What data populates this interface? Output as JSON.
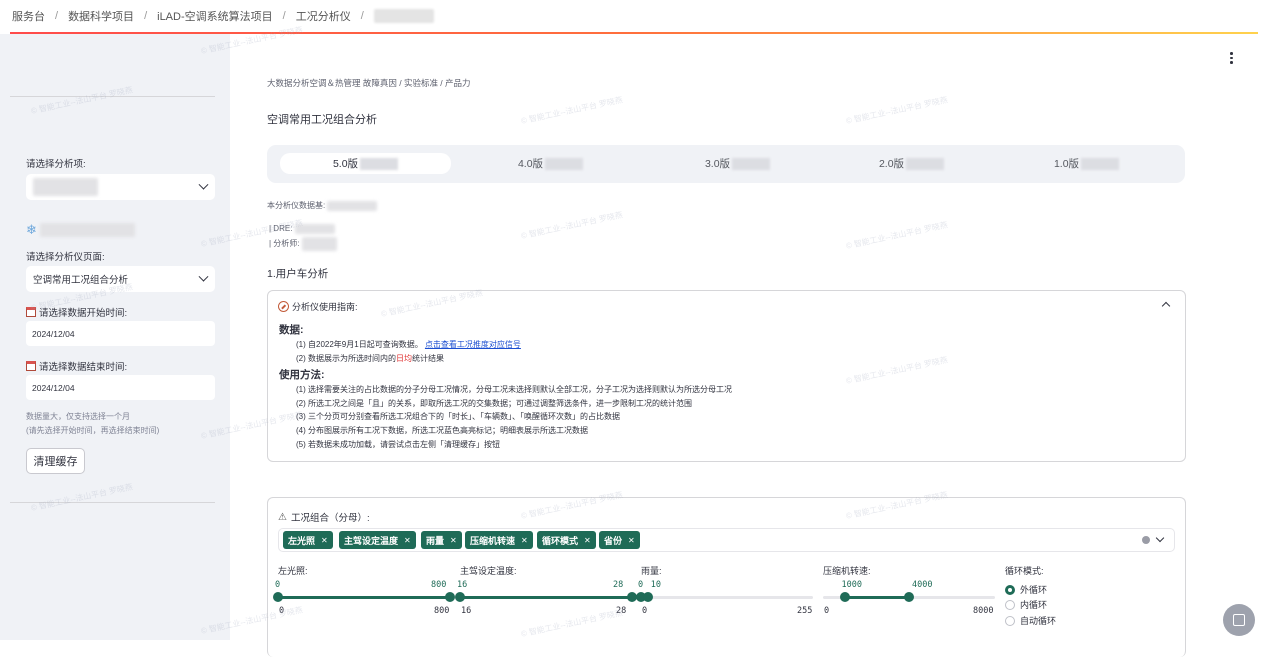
{
  "breadcrumb": {
    "items": [
      "服务台",
      "数据科学项目",
      "iLAD-空调系统算法项目",
      "工况分析仪"
    ],
    "separator": "/"
  },
  "watermark": "© 智能工业--法山平台 罗晓燕",
  "sidebar": {
    "analysis_item_label": "请选择分析项:",
    "page_label": "请选择分析仪页面:",
    "page_value": "空调常用工况组合分析",
    "start_label": "请选择数据开始时间:",
    "start_value": "2024/12/04",
    "end_label": "请选择数据结束时间:",
    "end_value": "2024/12/04",
    "note_line1": "数据量大，仅支持选择一个月",
    "note_line2": "(请先选择开始时间，再选择结束时间)",
    "clear_cache": "清理缓存"
  },
  "main": {
    "path_text": "大数据分析空调＆热管理 故障真因 / 实验标准 / 产品力",
    "title": "空调常用工况组合分析",
    "tabs": [
      "5.0版",
      "4.0版",
      "3.0版",
      "2.0版",
      "1.0版"
    ],
    "active_tab": 0,
    "meta_base": "本分析仪数据基:",
    "meta_dre": "| DRE:",
    "meta_analyst": "| 分析师:",
    "section_title": "1.用户车分析"
  },
  "guide": {
    "header": "分析仪使用指南:",
    "data_heading": "数据:",
    "data_line1_prefix": "(1) 自2022年9月1日起可查询数据。",
    "data_line1_link": "点击查看工况推度对应信号",
    "data_line2_prefix": "(2) 数据展示为所选时间内的",
    "data_line2_red": "日均",
    "data_line2_suffix": "统计结果",
    "method_heading": "使用方法:",
    "method_lines": [
      "(1) 选择需要关注的占比数据的分子分母工况情况，分母工况未选择则默认全部工况，分子工况为选择则默认为所选分母工况",
      "(2) 所选工况之间是「且」的关系，即取所选工况的交集数据；可通过调整筛选条件，进一步限制工况的统计范围",
      "(3) 三个分页可分别查看所选工况组合下的「时长」、「车辆数」、「唤醒循环次数」的占比数据",
      "(4) 分布图展示所有工况下数据，所选工况蓝色高亮标记；明细表展示所选工况数据",
      "(5) 若数据未成功加载，请尝试点击左侧「清理缓存」按钮"
    ]
  },
  "combo": {
    "header": "工况组合（分母）:",
    "tags": [
      "左光照",
      "主驾设定温度",
      "雨量",
      "压缩机转速",
      "循环模式",
      "省份"
    ],
    "sliders": [
      {
        "label": "左光照:",
        "low": 0,
        "high": 800,
        "min": 0,
        "max": 800,
        "low_label": "0",
        "high_label": "800",
        "min_label": "0",
        "max_label": "800"
      },
      {
        "label": "主驾设定温度:",
        "low": 16,
        "high": 28,
        "min": 16,
        "max": 28,
        "low_label": "16",
        "high_label": "28",
        "min_label": "16",
        "max_label": "28"
      },
      {
        "label": "雨量:",
        "low": 0,
        "high": 10,
        "min": 0,
        "max": 255,
        "low_label": "0",
        "high_label": "10",
        "min_label": "0",
        "max_label": "255"
      },
      {
        "label": "压缩机转速:",
        "low": 1000,
        "high": 4000,
        "min": 0,
        "max": 8000,
        "low_label": "1000",
        "high_label": "4000",
        "min_label": "0",
        "max_label": "8000"
      }
    ],
    "cycle_label": "循环模式:",
    "cycle_options": [
      "外循环",
      "内循环",
      "自动循环"
    ],
    "cycle_selected": 0
  }
}
